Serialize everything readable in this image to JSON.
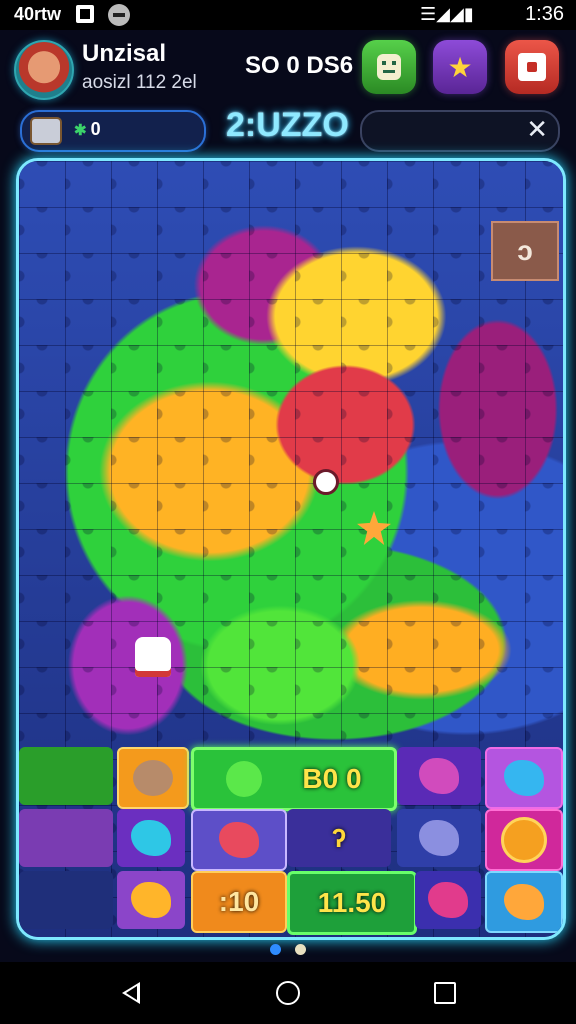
{
  "status_bar": {
    "carrier": "40rtw",
    "time": "1:36",
    "signal_icon": "signal-icon"
  },
  "header": {
    "player_name": "Unzisal",
    "player_sub": "aosizl 112 2el",
    "score": "SO 0 DS6",
    "buttons": [
      {
        "name": "face-icon"
      },
      {
        "name": "star-icon",
        "glyph": "★"
      },
      {
        "name": "puzzle-icon"
      }
    ]
  },
  "toolbar": {
    "coins": "0",
    "level_title": "2:UZZO",
    "search_placeholder": "",
    "close_glyph": "✕"
  },
  "board": {
    "corner_tile_label": "ͻ"
  },
  "tray": {
    "score_a": "B0 0",
    "score_b": ":10",
    "score_c": "11.50",
    "glyph_tile": "ʔ"
  },
  "colors": {
    "accent_cyan": "#7ee8ff",
    "green": "#2fd13c",
    "purple": "#8d4bd8",
    "red": "#ec5648",
    "orange": "#ffa73a"
  },
  "pager": {
    "pages": 2,
    "active": 1
  }
}
